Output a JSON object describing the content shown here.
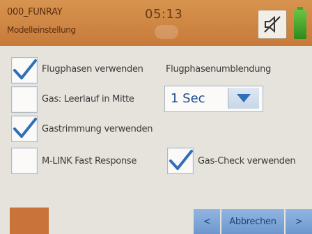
{
  "header": {
    "model_name": "000_FUNRAY",
    "screen_name": "Modelleinstellung",
    "clock": "05:13"
  },
  "options": {
    "flight_phases": {
      "label": "Flugphasen verwenden",
      "checked": true
    },
    "throttle_idle_center": {
      "label": "Gas: Leerlauf in Mitte",
      "checked": false
    },
    "throttle_trim": {
      "label": "Gastrimmung verwenden",
      "checked": true
    },
    "mlink_fast_response": {
      "label": "M-LINK Fast Response",
      "checked": false
    },
    "throttle_check": {
      "label": "Gas-Check verwenden",
      "checked": true
    }
  },
  "phase_transition": {
    "label": "Flugphasenumblendung",
    "value": "1 Sec"
  },
  "footer": {
    "prev_label": "<",
    "cancel_label": "Abbrechen",
    "next_label": ">"
  },
  "colors": {
    "header": "#c77a3a",
    "button": "#7aa2d6",
    "check": "#2f6fb8",
    "battery": "#4ba02e"
  },
  "icons": {
    "mute": "speaker-muted-icon",
    "battery": "battery-icon",
    "dropdown": "triangle-down-icon",
    "check": "checkmark-icon"
  }
}
